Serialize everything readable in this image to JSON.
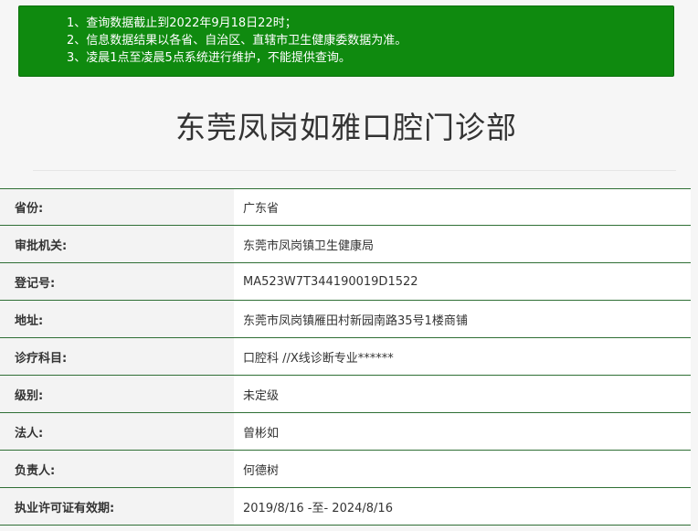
{
  "notice": {
    "lines": [
      "1、查询数据截止到2022年9月18日22时；",
      "2、信息数据结果以各省、自治区、直辖市卫生健康委数据为准。",
      "3、凌晨1点至凌晨5点系统进行维护，不能提供查询。"
    ]
  },
  "page_title": "东莞凤岗如雅口腔门诊部",
  "rows": [
    {
      "label": "省份:",
      "value": "广东省"
    },
    {
      "label": "审批机关:",
      "value": "东莞市凤岗镇卫生健康局"
    },
    {
      "label": "登记号:",
      "value": "MA523W7T344190019D1522"
    },
    {
      "label": "地址:",
      "value": "东莞市凤岗镇雁田村新园南路35号1楼商铺"
    },
    {
      "label": "诊疗科目:",
      "value": "口腔科 //X线诊断专业******"
    },
    {
      "label": "级别:",
      "value": "未定级"
    },
    {
      "label": "法人:",
      "value": "曾彬如"
    },
    {
      "label": "负责人:",
      "value": "何德树"
    },
    {
      "label": "执业许可证有效期:",
      "value": "2019/8/16 -至- 2024/8/16"
    }
  ],
  "colors": {
    "notice_bg": "#0f8a0f",
    "row_border": "#2f6f35",
    "label_bg": "#f3f3f3",
    "value_bg": "#ffffff"
  }
}
